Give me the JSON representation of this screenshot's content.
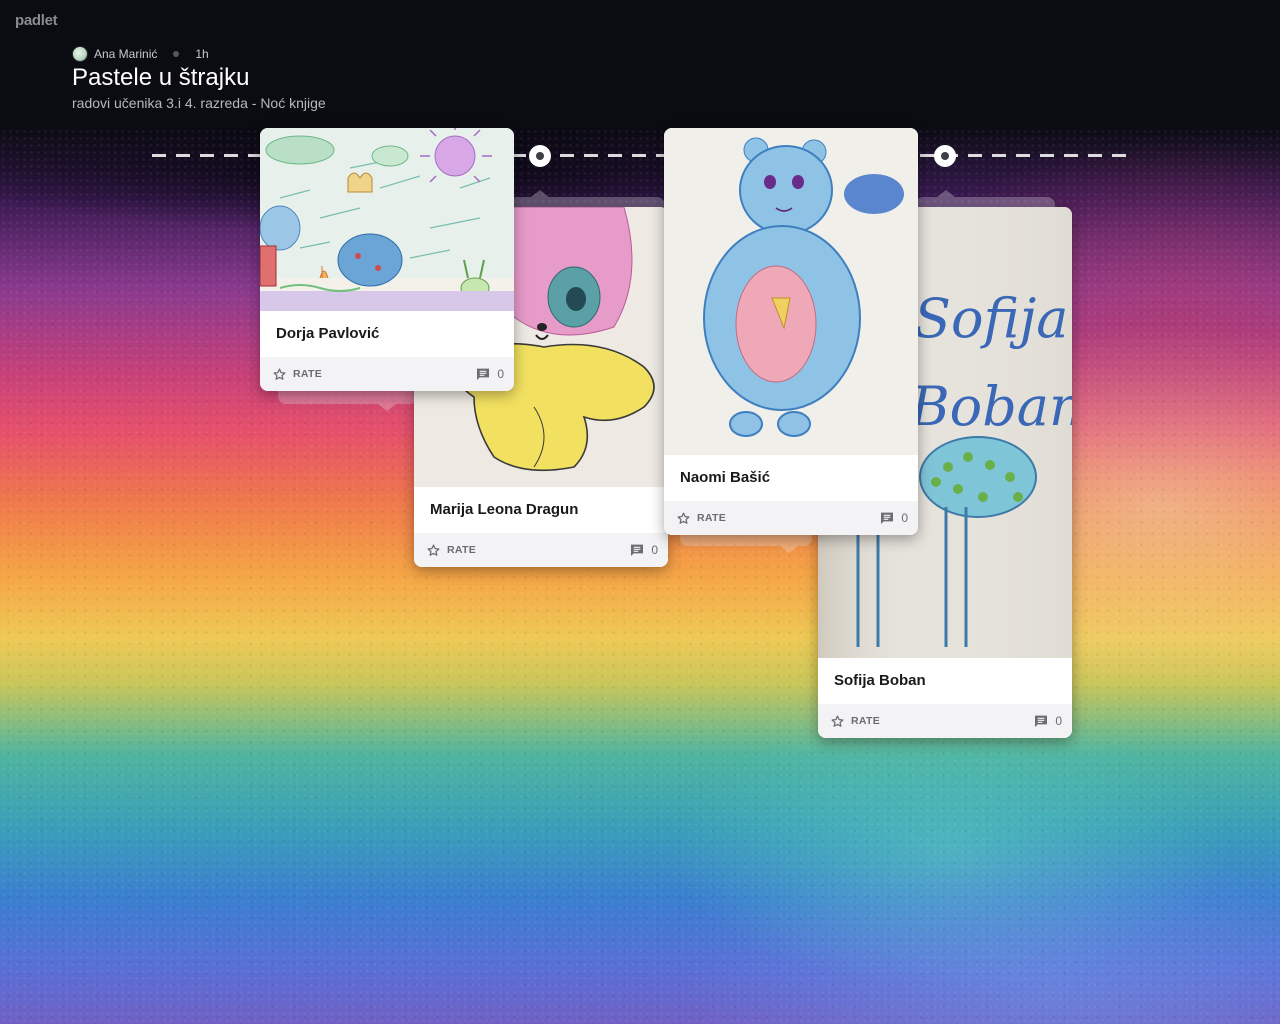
{
  "app": {
    "logo_text": "padlet"
  },
  "header": {
    "author": "Ana Marinić",
    "time_ago": "1h",
    "title": "Pastele u štrajku",
    "subtitle": "radovi učenika 3.i 4. razreda - Noć knjige"
  },
  "posts": [
    {
      "name": "Dorja Pavlović",
      "rate_label": "RATE",
      "comment_count": "0",
      "art_icon": "drawing-landscape-icon"
    },
    {
      "name": "Marija Leona Dragun",
      "rate_label": "RATE",
      "comment_count": "0",
      "art_icon": "drawing-pink-bear-icon"
    },
    {
      "name": "Naomi Bašić",
      "rate_label": "RATE",
      "comment_count": "0",
      "art_icon": "drawing-blue-bear-icon"
    },
    {
      "name": "Sofija Boban",
      "rate_label": "RATE",
      "comment_count": "0",
      "art_icon": "drawing-giraffe-icon",
      "art_text_line1": "Sofija",
      "art_text_line2": "Boban"
    }
  ],
  "colors": {
    "header_bg": "#0b0b12",
    "card_bg": "#ffffff",
    "footer_bg": "#f3f3f5"
  }
}
